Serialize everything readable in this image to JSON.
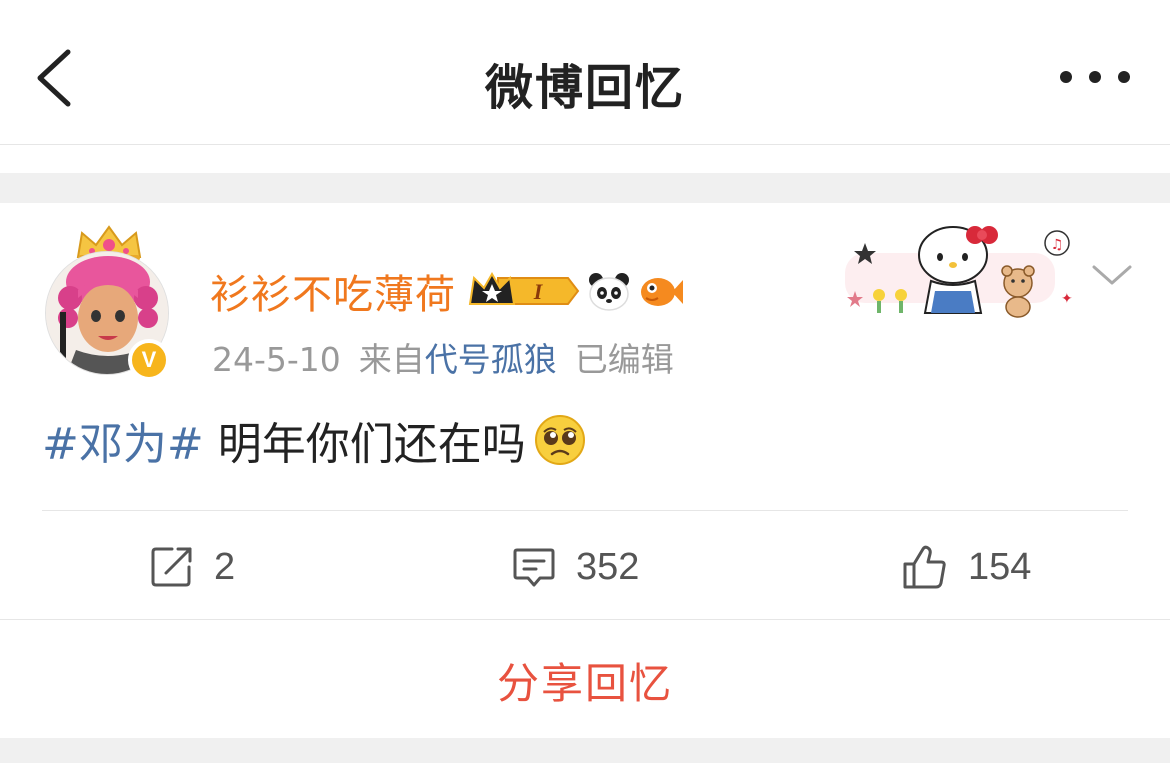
{
  "header": {
    "title": "微博回忆",
    "back_icon": "chevron-left-icon",
    "more_icon": "more-dots-icon"
  },
  "post": {
    "username": "衫衫不吃薄荷",
    "level_badge": "I",
    "date": "24-5-10",
    "from_label": "来自",
    "source": "代号孤狼",
    "edited": "已编辑",
    "hashtag": "#邓为#",
    "text": "明年你们还在吗",
    "verified_badge": "V",
    "content_emoji": "pleading-face-icon"
  },
  "actions": {
    "repost_count": "2",
    "comment_count": "352",
    "like_count": "154"
  },
  "footer": {
    "share_label": "分享回忆"
  },
  "colors": {
    "username": "#f0781e",
    "link": "#4a72a6",
    "share": "#e8523f",
    "separator": "#f0f0f0"
  }
}
